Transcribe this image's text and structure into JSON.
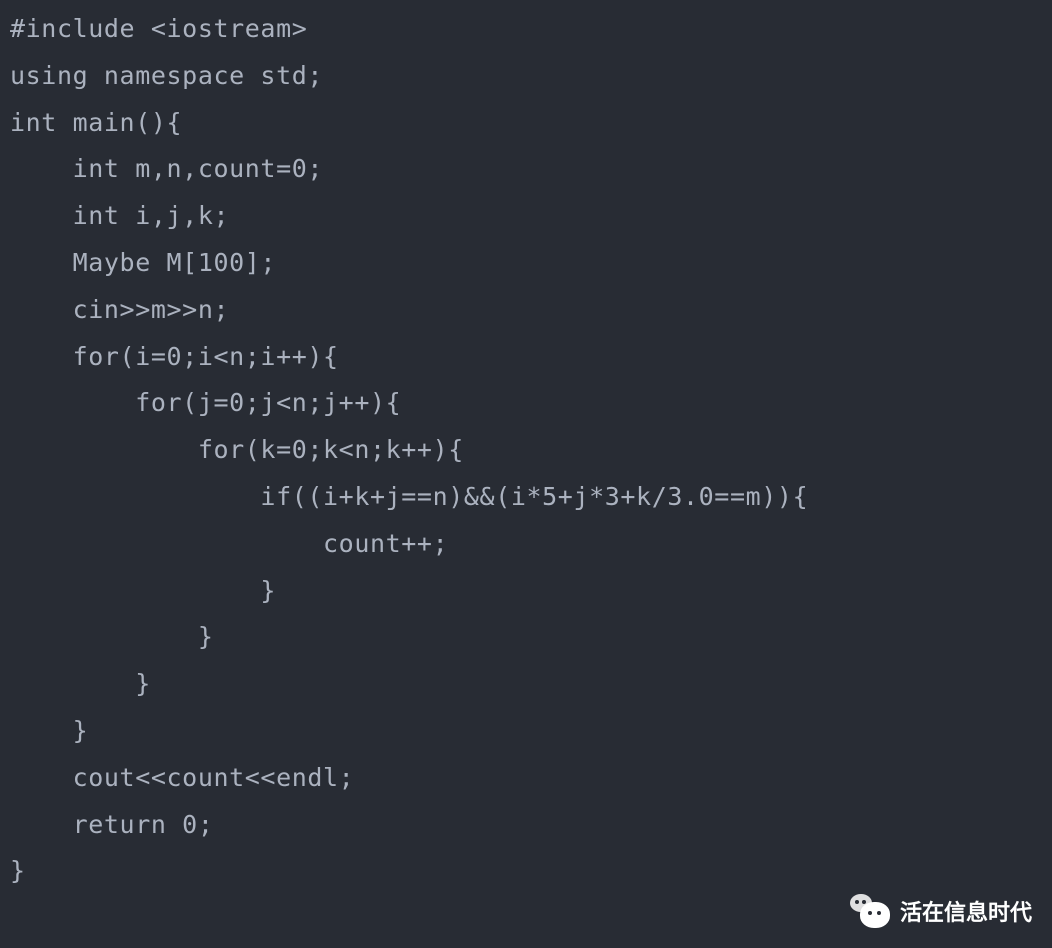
{
  "code": {
    "lines": [
      "#include <iostream>",
      "using namespace std;",
      "int main(){",
      "    int m,n,count=0;",
      "    int i,j,k;",
      "    Maybe M[100];",
      "    cin>>m>>n;",
      "    for(i=0;i<n;i++){",
      "        for(j=0;j<n;j++){",
      "            for(k=0;k<n;k++){",
      "                if((i+k+j==n)&&(i*5+j*3+k/3.0==m)){",
      "                    count++;",
      "                }",
      "            }",
      "        }",
      "    }",
      "    cout<<count<<endl;",
      "    return 0;",
      "}"
    ]
  },
  "watermark": {
    "label": "活在信息时代"
  }
}
